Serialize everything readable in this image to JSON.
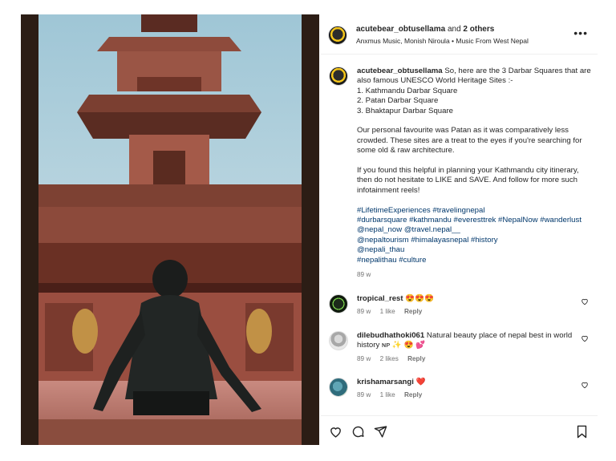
{
  "post": {
    "header": {
      "username": "acutebear_obtusellama",
      "joiner": "and",
      "others": "2 others",
      "subtitle": "Anxmus Music, Monish Niroula • Music From West Nepal"
    },
    "caption": {
      "username": "acutebear_obtusellama",
      "lines": [
        "So, here are the 3 Darbar Squares that are also famous UNESCO World Heritage Sites :-",
        "1. Kathmandu Darbar Square",
        "2. Patan Darbar Square",
        "3. Bhaktapur Darbar Square"
      ],
      "paragraph2": "Our personal favourite was Patan as it was comparatively less crowded. These sites are a treat to the eyes if you're searching for some old & raw architecture.",
      "paragraph3": "If you found this helpful in planning your Kathmandu city itinerary, then do not hesitate to LIKE and SAVE. And follow for more such infotainment reels!",
      "hashtag_lines": [
        "#LifetimeExperiences #travelingnepal",
        "#durbarsquare #kathmandu #everesttrek #NepalNow #wanderlust",
        "@nepal_now @travel.nepal__",
        "@nepaltourism #himalayasnepal #history",
        "@nepali_thau",
        "#nepalithau #culture"
      ],
      "timestamp": "89 w"
    },
    "comments": [
      {
        "username": "tropical_rest",
        "text": "😍😍😍",
        "time": "89 w",
        "likes": "1 like",
        "reply": "Reply"
      },
      {
        "username": "dilebudhathoki061",
        "text": "Natural beauty place of nepal best in world history ɴᴘ ✨ 😍 💕",
        "time": "89 w",
        "likes": "2 likes",
        "reply": "Reply"
      },
      {
        "username": "krishamarsangi",
        "text": "❤️",
        "time": "89 w",
        "likes": "1 like",
        "reply": "Reply"
      }
    ],
    "icons": {
      "more": "more-options-icon",
      "like": "heart-icon",
      "comment": "comment-icon",
      "share": "share-icon",
      "save": "bookmark-icon"
    }
  }
}
